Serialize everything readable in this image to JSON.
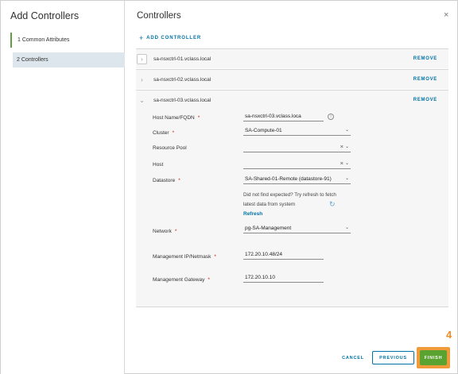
{
  "wizard": {
    "title": "Add Controllers",
    "steps": [
      {
        "label": "1  Common Attributes"
      },
      {
        "label": "2  Controllers"
      }
    ]
  },
  "main": {
    "title": "Controllers",
    "close_icon": "×",
    "add_controller_label": "ADD CONTROLLER",
    "add_icon": "+",
    "remove_label": "REMOVE",
    "controllers": [
      {
        "name": "sa-nsxctrl-01.vclass.local",
        "expanded": false
      },
      {
        "name": "sa-nsxctrl-02.vclass.local",
        "expanded": false
      },
      {
        "name": "sa-nsxctrl-03.vclass.local",
        "expanded": true
      }
    ]
  },
  "form": {
    "hostname_label": "Host Name/FQDN",
    "hostname_value": "sa-nsxctrl-03.vclass.loca",
    "cluster_label": "Cluster",
    "cluster_value": "SA-Compute-01",
    "resource_pool_label": "Resource Pool",
    "resource_pool_value": "",
    "host_label": "Host",
    "host_value": "",
    "datastore_label": "Datastore",
    "datastore_value": "SA-Shared-01-Remote (datastore-91)",
    "datastore_hint": "Did not find expected? Try refresh to fetch latest data from system",
    "refresh_label": "Refresh",
    "network_label": "Network",
    "network_value": "pg-SA-Management",
    "mgmt_ip_label": "Management IP/Netmask",
    "mgmt_ip_value": "172.20.10.48/24",
    "mgmt_gw_label": "Management Gateway",
    "mgmt_gw_value": "172.20.10.10",
    "required_mark": "*",
    "info_icon": "i",
    "caret": "⌄",
    "clear": "×"
  },
  "footer": {
    "cancel_label": "CANCEL",
    "previous_label": "PREVIOUS",
    "finish_label": "FINISH",
    "annotation_number": "4"
  },
  "colors": {
    "accent": "#0072a3",
    "finish_green": "#5aa331",
    "highlight_orange": "#f09a3a",
    "required_red": "#c92100"
  }
}
